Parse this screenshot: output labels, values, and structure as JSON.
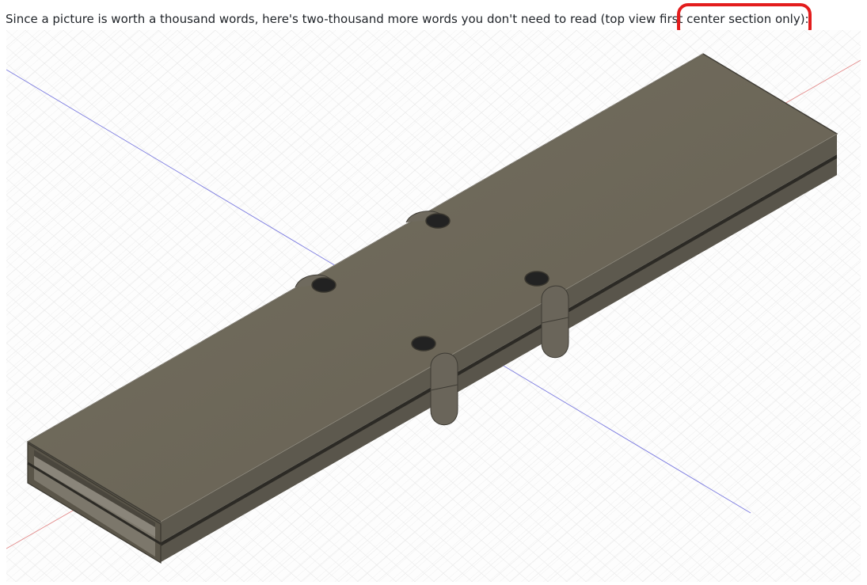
{
  "caption": {
    "text_before": "Since a picture is worth a thousand words, here's two-thousand more words you don't need to read (top view first",
    "text_highlight": "center section only):"
  },
  "annotation": {
    "color": "#e31d1d",
    "shape": "rounded-rectangle"
  },
  "viewport": {
    "model_color": "#6b665c",
    "grid_color": "#dcdcdc",
    "axis_colors": {
      "x": "#e05555",
      "y": "#6b6bd6"
    }
  },
  "toolbar": {
    "items": [
      {
        "icon": "orbit-icon",
        "has_dropdown": true
      },
      {
        "icon": "look-at-icon",
        "has_dropdown": false
      },
      {
        "icon": "pan-icon",
        "has_dropdown": false
      },
      {
        "icon": "zoom-icon",
        "has_dropdown": false
      },
      {
        "icon": "fit-icon",
        "has_dropdown": true
      },
      {
        "icon": "display-settings-icon",
        "has_dropdown": true
      },
      {
        "icon": "grid-settings-icon",
        "has_dropdown": true
      },
      {
        "icon": "viewports-icon",
        "has_dropdown": true
      }
    ]
  }
}
